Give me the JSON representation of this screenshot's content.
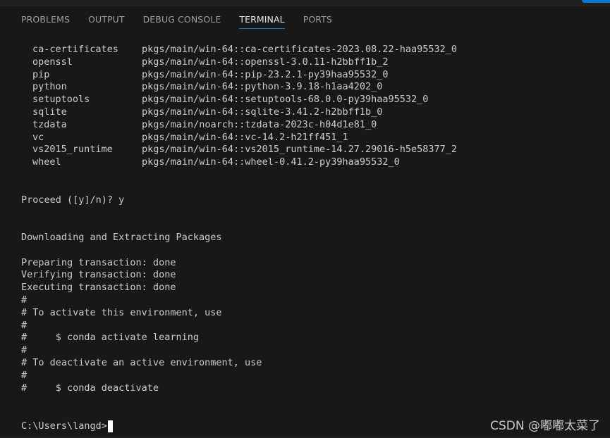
{
  "panel": {
    "tabs": [
      {
        "label": "PROBLEMS",
        "active": false
      },
      {
        "label": "OUTPUT",
        "active": false
      },
      {
        "label": "DEBUG CONSOLE",
        "active": false
      },
      {
        "label": "TERMINAL",
        "active": true
      },
      {
        "label": "PORTS",
        "active": false
      }
    ],
    "accent_color": "#0078d4"
  },
  "terminal": {
    "packages": [
      {
        "name": "ca-certificates",
        "spec": "pkgs/main/win-64::ca-certificates-2023.08.22-haa95532_0"
      },
      {
        "name": "openssl",
        "spec": "pkgs/main/win-64::openssl-3.0.11-h2bbff1b_2"
      },
      {
        "name": "pip",
        "spec": "pkgs/main/win-64::pip-23.2.1-py39haa95532_0"
      },
      {
        "name": "python",
        "spec": "pkgs/main/win-64::python-3.9.18-h1aa4202_0"
      },
      {
        "name": "setuptools",
        "spec": "pkgs/main/win-64::setuptools-68.0.0-py39haa95532_0"
      },
      {
        "name": "sqlite",
        "spec": "pkgs/main/win-64::sqlite-3.41.2-h2bbff1b_0"
      },
      {
        "name": "tzdata",
        "spec": "pkgs/main/noarch::tzdata-2023c-h04d1e81_0"
      },
      {
        "name": "vc",
        "spec": "pkgs/main/win-64::vc-14.2-h21ff451_1"
      },
      {
        "name": "vs2015_runtime",
        "spec": "pkgs/main/win-64::vs2015_runtime-14.27.29016-h5e58377_2"
      },
      {
        "name": "wheel",
        "spec": "pkgs/main/win-64::wheel-0.41.2-py39haa95532_0"
      }
    ],
    "proceed": "Proceed ([y]/n)? y",
    "downloading": "Downloading and Extracting Packages",
    "preparing": "Preparing transaction: done",
    "verifying": "Verifying transaction: done",
    "executing": "Executing transaction: done",
    "comment_1": "#",
    "activate_note": "# To activate this environment, use",
    "comment_2": "#",
    "activate_cmd": "#     $ conda activate learning",
    "comment_3": "#",
    "deactivate_note": "# To deactivate an active environment, use",
    "comment_4": "#",
    "deactivate_cmd": "#     $ conda deactivate",
    "prompt": "C:\\Users\\langd>"
  },
  "watermark": "CSDN @嘟嘟太菜了"
}
